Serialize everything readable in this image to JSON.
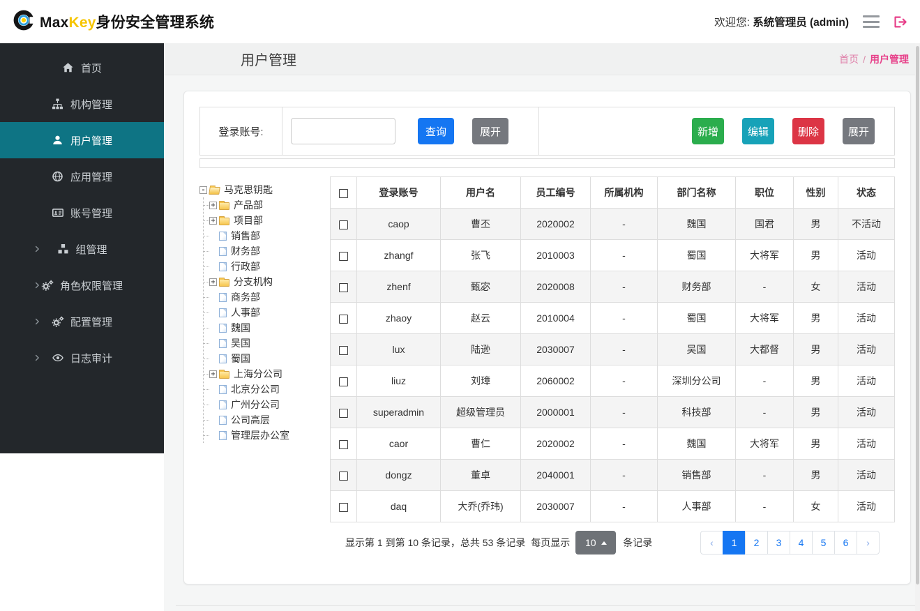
{
  "header": {
    "brand": {
      "max": "Max",
      "key": "Key",
      "suffix": "身份安全管理系统"
    },
    "welcome_prefix": "欢迎您:",
    "welcome_user": "系统管理员 (admin)"
  },
  "sidebar": {
    "items": [
      {
        "label": "首页",
        "icon": "home-icon",
        "active": false,
        "expandable": false
      },
      {
        "label": "机构管理",
        "icon": "sitemap-icon",
        "active": false,
        "expandable": false
      },
      {
        "label": "用户管理",
        "icon": "user-icon",
        "active": true,
        "expandable": false
      },
      {
        "label": "应用管理",
        "icon": "globe-icon",
        "active": false,
        "expandable": false
      },
      {
        "label": "账号管理",
        "icon": "id-card-icon",
        "active": false,
        "expandable": false
      },
      {
        "label": "组管理",
        "icon": "cubes-icon",
        "active": false,
        "expandable": true
      },
      {
        "label": "角色权限管理",
        "icon": "gears-icon",
        "active": false,
        "expandable": true
      },
      {
        "label": "配置管理",
        "icon": "gears-icon",
        "active": false,
        "expandable": true
      },
      {
        "label": "日志审计",
        "icon": "eye-icon",
        "active": false,
        "expandable": true
      }
    ]
  },
  "page": {
    "title": "用户管理",
    "breadcrumb": {
      "home": "首页",
      "separator": "/",
      "current": "用户管理"
    }
  },
  "search": {
    "label": "登录账号:",
    "input_value": "",
    "query_label": "查询",
    "expand_label": "展开"
  },
  "toolbar": {
    "add_label": "新增",
    "edit_label": "编辑",
    "delete_label": "删除",
    "expand_label": "展开"
  },
  "tree": {
    "nodes": [
      {
        "label": "马克思钥匙",
        "toggle": "-",
        "type": "folder-open"
      },
      {
        "label": "产品部",
        "toggle": "+",
        "type": "folder"
      },
      {
        "label": "项目部",
        "toggle": "+",
        "type": "folder"
      },
      {
        "label": "销售部",
        "toggle": "",
        "type": "leaf"
      },
      {
        "label": "财务部",
        "toggle": "",
        "type": "leaf"
      },
      {
        "label": "行政部",
        "toggle": "",
        "type": "leaf"
      },
      {
        "label": "分支机构",
        "toggle": "+",
        "type": "folder"
      },
      {
        "label": "商务部",
        "toggle": "",
        "type": "leaf"
      },
      {
        "label": "人事部",
        "toggle": "",
        "type": "leaf"
      },
      {
        "label": "魏国",
        "toggle": "",
        "type": "leaf"
      },
      {
        "label": "吴国",
        "toggle": "",
        "type": "leaf"
      },
      {
        "label": "蜀国",
        "toggle": "",
        "type": "leaf"
      },
      {
        "label": "上海分公司",
        "toggle": "+",
        "type": "folder"
      },
      {
        "label": "北京分公司",
        "toggle": "",
        "type": "leaf"
      },
      {
        "label": "广州分公司",
        "toggle": "",
        "type": "leaf"
      },
      {
        "label": "公司高层",
        "toggle": "",
        "type": "leaf"
      },
      {
        "label": "管理层办公室",
        "toggle": "",
        "type": "leaf"
      }
    ]
  },
  "table": {
    "columns": [
      "登录账号",
      "用户名",
      "员工编号",
      "所属机构",
      "部门名称",
      "职位",
      "性别",
      "状态"
    ],
    "rows": [
      [
        "caop",
        "曹丕",
        "2020002",
        "-",
        "魏国",
        "国君",
        "男",
        "不活动"
      ],
      [
        "zhangf",
        "张飞",
        "2010003",
        "-",
        "蜀国",
        "大将军",
        "男",
        "活动"
      ],
      [
        "zhenf",
        "甄宓",
        "2020008",
        "-",
        "财务部",
        "-",
        "女",
        "活动"
      ],
      [
        "zhaoy",
        "赵云",
        "2010004",
        "-",
        "蜀国",
        "大将军",
        "男",
        "活动"
      ],
      [
        "lux",
        "陆逊",
        "2030007",
        "-",
        "吴国",
        "大都督",
        "男",
        "活动"
      ],
      [
        "liuz",
        "刘璋",
        "2060002",
        "-",
        "深圳分公司",
        "-",
        "男",
        "活动"
      ],
      [
        "superadmin",
        "超级管理员",
        "2000001",
        "-",
        "科技部",
        "-",
        "男",
        "活动"
      ],
      [
        "caor",
        "曹仁",
        "2020002",
        "-",
        "魏国",
        "大将军",
        "男",
        "活动"
      ],
      [
        "dongz",
        "董卓",
        "2040001",
        "-",
        "销售部",
        "-",
        "男",
        "活动"
      ],
      [
        "daq",
        "大乔(乔玮)",
        "2030007",
        "-",
        "人事部",
        "-",
        "女",
        "活动"
      ]
    ]
  },
  "pagination": {
    "summary": "显示第 1 到第 10 条记录，总共 53 条记录",
    "per_page_prefix": "每页显示",
    "page_size": "10",
    "per_page_suffix": "条记录",
    "prev": "‹",
    "next": "›",
    "pages": [
      "1",
      "2",
      "3",
      "4",
      "5",
      "6"
    ],
    "active_page": "1"
  },
  "colors": {
    "sidebar_bg": "#23272b",
    "sidebar_active": "#0e7484",
    "primary_blue": "#1576f2",
    "success_green": "#2bad4d",
    "info_teal": "#17a2b8",
    "danger_red": "#dc3545",
    "secondary_gray": "#75787e",
    "brand_yellow": "#f6c500",
    "breadcrumb_pink": "#e7418a",
    "stripe_gray": "#f4f4f4"
  }
}
